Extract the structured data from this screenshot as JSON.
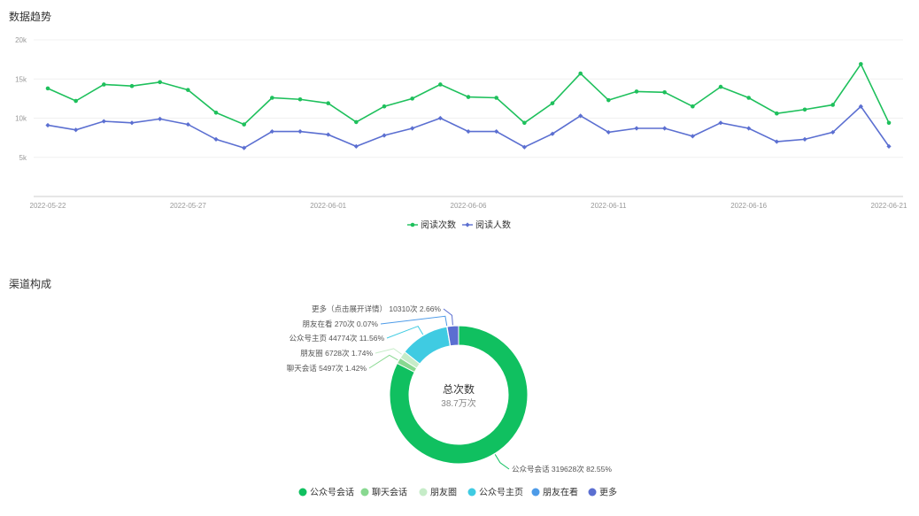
{
  "sections": {
    "trend_title": "数据趋势",
    "channel_title": "渠道构成"
  },
  "colors": {
    "reads": "#1ec05c",
    "readers": "#5b6fd1",
    "grid": "#f0f0f0",
    "axis": "#cccccc"
  },
  "chart_data": [
    {
      "type": "line",
      "x": [
        "2022-05-22",
        "2022-05-23",
        "2022-05-24",
        "2022-05-25",
        "2022-05-26",
        "2022-05-27",
        "2022-05-28",
        "2022-05-29",
        "2022-05-30",
        "2022-05-31",
        "2022-06-01",
        "2022-06-02",
        "2022-06-03",
        "2022-06-04",
        "2022-06-05",
        "2022-06-06",
        "2022-06-07",
        "2022-06-08",
        "2022-06-09",
        "2022-06-10",
        "2022-06-11",
        "2022-06-12",
        "2022-06-13",
        "2022-06-14",
        "2022-06-15",
        "2022-06-16",
        "2022-06-17",
        "2022-06-18",
        "2022-06-19",
        "2022-06-20",
        "2022-06-21"
      ],
      "x_tick_labels": [
        "2022-05-22",
        "2022-05-27",
        "2022-06-01",
        "2022-06-06",
        "2022-06-11",
        "2022-06-16",
        "2022-06-21"
      ],
      "y_tick_labels": [
        "5k",
        "10k",
        "15k",
        "20k"
      ],
      "y_ticks": [
        5000,
        10000,
        15000,
        20000
      ],
      "ylim": [
        0,
        20000
      ],
      "grid": true,
      "legend": "bottom-center",
      "series": [
        {
          "name": "阅读次数",
          "values": [
            13800,
            12200,
            14300,
            14100,
            14600,
            13600,
            10700,
            9200,
            12600,
            12400,
            11900,
            9500,
            11500,
            12500,
            14300,
            12700,
            12600,
            9400,
            11900,
            15700,
            12300,
            13400,
            13300,
            11500,
            14000,
            12600,
            10600,
            11100,
            11700,
            16900,
            9400
          ]
        },
        {
          "name": "阅读人数",
          "values": [
            9100,
            8500,
            9600,
            9400,
            9900,
            9200,
            7300,
            6200,
            8300,
            8300,
            7900,
            6400,
            7800,
            8700,
            10000,
            8300,
            8300,
            6300,
            8000,
            10300,
            8200,
            8700,
            8700,
            7700,
            9400,
            8700,
            7000,
            7300,
            8200,
            11500,
            6400
          ]
        }
      ]
    },
    {
      "type": "pie",
      "center_title": "总次数",
      "center_value": "38.7万次",
      "legend": "bottom-center",
      "slices": [
        {
          "name": "公众号会话",
          "value": 319628,
          "percent": "82.55%",
          "label": "公众号会话 319628次 82.55%",
          "color": "#10c060"
        },
        {
          "name": "聊天会话",
          "value": 5497,
          "percent": "1.42%",
          "label": "聊天会话 5497次 1.42%",
          "color": "#88d890"
        },
        {
          "name": "朋友圈",
          "value": 6728,
          "percent": "1.74%",
          "label": "朋友圈 6728次 1.74%",
          "color": "#c6ecc8"
        },
        {
          "name": "公众号主页",
          "value": 44774,
          "percent": "11.56%",
          "label": "公众号主页 44774次 11.56%",
          "color": "#3fcbe2"
        },
        {
          "name": "朋友在看",
          "value": 270,
          "percent": "0.07%",
          "label": "朋友在看 270次 0.07%",
          "color": "#4d9be8"
        },
        {
          "name": "更多",
          "value": 10310,
          "percent": "2.66%",
          "label": "更多（点击展开详情） 10310次 2.66%",
          "color": "#5b6fd1"
        }
      ]
    }
  ]
}
